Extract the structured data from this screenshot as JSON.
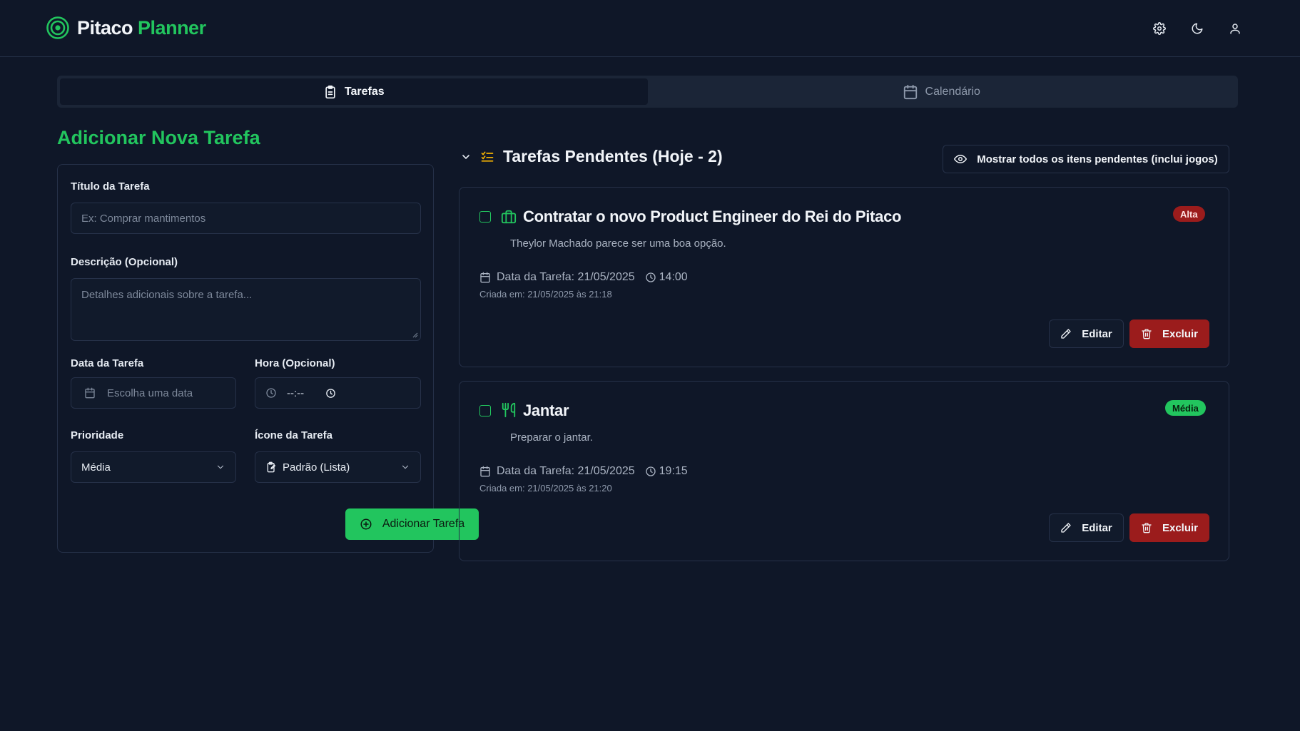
{
  "app": {
    "brand_first": "Pitaco",
    "brand_second": "Planner",
    "colors": {
      "accent": "#22c55e",
      "danger": "#9b1c1c",
      "background": "#0f1728"
    }
  },
  "header": {
    "icons": [
      "settings-icon",
      "moon-icon",
      "user-icon"
    ]
  },
  "tabs": [
    {
      "label": "Tarefas",
      "icon": "clipboard-icon",
      "active": true
    },
    {
      "label": "Calendário",
      "icon": "calendar-icon",
      "active": false
    }
  ],
  "form": {
    "title": "Adicionar Nova Tarefa",
    "title_label": "Título da Tarefa",
    "title_placeholder": "Ex: Comprar mantimentos",
    "description_label": "Descrição (Opcional)",
    "description_placeholder": "Detalhes adicionais sobre a tarefa...",
    "date_label": "Data da Tarefa",
    "date_placeholder": "Escolha uma data",
    "time_label": "Hora (Opcional)",
    "time_value": "--:--",
    "priority_label": "Prioridade",
    "priority_value": "Média",
    "icon_label": "Ícone da Tarefa",
    "icon_value": "Padrão (Lista)",
    "submit_label": "Adicionar Tarefa"
  },
  "list": {
    "title": "Tarefas Pendentes (Hoje - 2)",
    "show_all_label": "Mostrar todos os itens pendentes (inclui jogos)",
    "tasks": [
      {
        "icon": "briefcase-icon",
        "title": "Contratar o novo Product Engineer do Rei do Pitaco",
        "description": "Theylor Machado parece ser uma boa opção.",
        "date_text": "Data da Tarefa: 21/05/2025",
        "time": "14:00",
        "created": "Criada em: 21/05/2025 às 21:18",
        "priority": "Alta",
        "priority_color": "#9b1c1c",
        "edit_label": "Editar",
        "delete_label": "Excluir"
      },
      {
        "icon": "utensils-icon",
        "title": "Jantar",
        "description": "Preparar o jantar.",
        "date_text": "Data da Tarefa: 21/05/2025",
        "time": "19:15",
        "created": "Criada em: 21/05/2025 às 21:20",
        "priority": "Média",
        "priority_color": "#22c55e",
        "edit_label": "Editar",
        "delete_label": "Excluir"
      }
    ]
  }
}
